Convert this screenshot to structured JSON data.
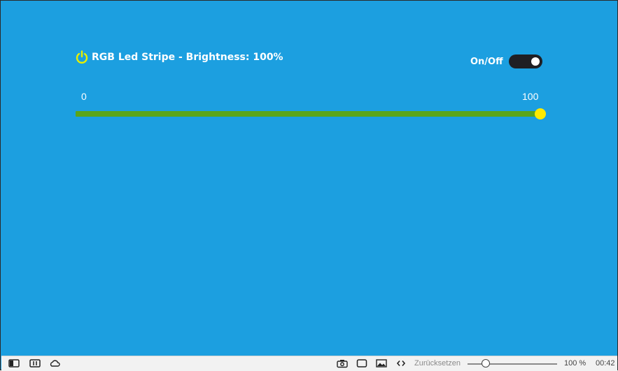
{
  "widget": {
    "title": "RGB Led Stripe - Brightness: 100%",
    "icon": "power-icon",
    "accent_color": "#e8f000",
    "background_color": "#1c9fe0"
  },
  "toggle": {
    "label": "On/Off",
    "state": "on"
  },
  "slider": {
    "min_label": "0",
    "max_label": "100",
    "min": 0,
    "max": 100,
    "value": 100,
    "fill_color": "#5aa51a",
    "thumb_color": "#ffea00"
  },
  "statusbar": {
    "left_icons": [
      "sidebar-toggle-icon",
      "split-view-icon",
      "cloud-icon"
    ],
    "right_icons": [
      "camera-icon",
      "window-icon",
      "image-icon",
      "code-icon"
    ],
    "reset_label": "Zurücksetzen",
    "zoom_label": "100 %",
    "zoom_fraction": 0.2,
    "clock": "00:42"
  }
}
